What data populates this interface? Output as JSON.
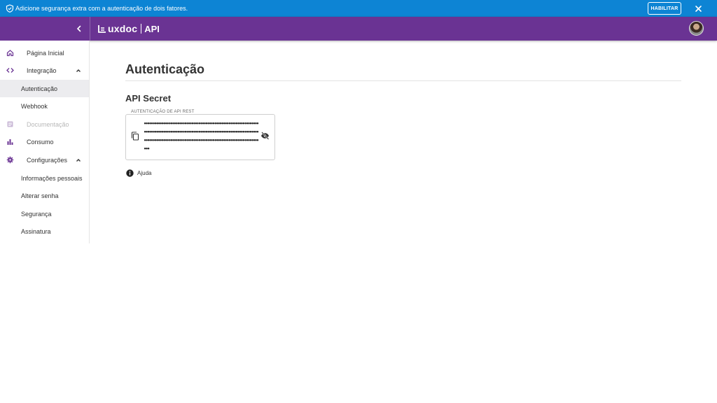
{
  "banner": {
    "message": "Adicione segurança extra com a autenticação de dois fatores.",
    "enable_label": "HABILITAR",
    "color": "#0d84d4"
  },
  "appbar": {
    "brand": "uxdoc",
    "product": "API",
    "color": "#6a3393"
  },
  "sidebar": {
    "items": [
      {
        "label": "Página Inicial",
        "icon": "home-icon"
      },
      {
        "label": "Integração",
        "icon": "code-icon",
        "expanded": true
      },
      {
        "label": "Autenticação",
        "sub": true,
        "active": true
      },
      {
        "label": "Webhook",
        "sub": true
      },
      {
        "label": "Documentação",
        "icon": "document-icon",
        "disabled": true
      },
      {
        "label": "Consumo",
        "icon": "bar-chart-icon"
      },
      {
        "label": "Configurações",
        "icon": "gear-icon",
        "expanded": true
      },
      {
        "label": "Informações pessoais",
        "sub": true
      },
      {
        "label": "Alterar senha",
        "sub": true
      },
      {
        "label": "Segurança",
        "sub": true
      },
      {
        "label": "Assinatura",
        "sub": true
      }
    ]
  },
  "main": {
    "title": "Autenticação",
    "section_title": "API Secret",
    "secret_field": {
      "legend": "AUTENTICAÇÃO DE API REST",
      "value": "••••••••••••••••••••••••••••••••••••••••••••••••••••••••••••••••••••••••••••••••••••••••••••••••••••••••••••••••••••••••••••••••••••••••••••••••••••••••••••••••••••••••••••••••••••••••••••••••••••••"
    },
    "help_label": "Ajuda"
  }
}
